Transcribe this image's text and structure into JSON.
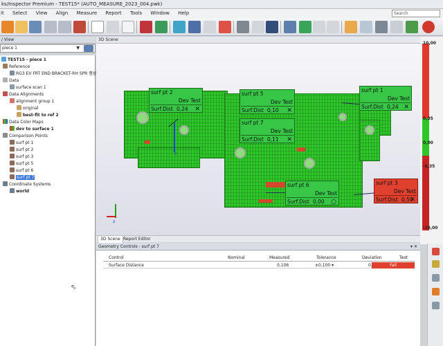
{
  "window": {
    "title": "ks/Inspector Premium - TEST15* (AUTO_MEASURE_2023_004.pwk)"
  },
  "menu": {
    "items": [
      "it",
      "Select",
      "View",
      "Align",
      "Measure",
      "Report",
      "Tools",
      "Window",
      "Help"
    ],
    "search_label": "Search"
  },
  "tree_panel": {
    "header": "/ View",
    "piece_selector": "piece 1",
    "root": "TEST15 - piece 1",
    "nodes": [
      {
        "label": "Reference",
        "indent": 1
      },
      {
        "label": "RG3 EV FRT END BRACKET-RH SPR 캠상",
        "indent": 2
      },
      {
        "label": "Data",
        "indent": 1
      },
      {
        "label": "surface scan 1",
        "indent": 2
      },
      {
        "label": "Data Alignments",
        "indent": 1
      },
      {
        "label": "alignment group 1",
        "indent": 2
      },
      {
        "label": "original",
        "indent": 3
      },
      {
        "label": "best-fit to ref 2",
        "indent": 3
      },
      {
        "label": "Data Color Maps",
        "indent": 1
      },
      {
        "label": "dev to surface 1",
        "indent": 2
      },
      {
        "label": "Comparison Points",
        "indent": 1
      },
      {
        "label": "surf pt 1",
        "indent": 2
      },
      {
        "label": "surf pt 2",
        "indent": 2
      },
      {
        "label": "surf pt 3",
        "indent": 2
      },
      {
        "label": "surf pt 5",
        "indent": 2
      },
      {
        "label": "surf pt 6",
        "indent": 2
      },
      {
        "label": "surf pt 7",
        "indent": 2
      },
      {
        "label": "Coordinate Systems",
        "indent": 1
      },
      {
        "label": "world",
        "indent": 2
      }
    ]
  },
  "scene": {
    "header": "3D Scene",
    "axis_label": "z",
    "callouts": [
      {
        "name": "surf pt 2",
        "head": "Dev Test",
        "label": "Surf.Dist",
        "value": "0,24",
        "mark": "✕",
        "status": "pass"
      },
      {
        "name": "surf pt 5",
        "head": "Dev Test",
        "label": "Surf.Dist",
        "value": "0,10",
        "mark": "✕",
        "status": "pass"
      },
      {
        "name": "surf pt 7",
        "head": "Dev Test",
        "label": "Surf.Dist",
        "value": "0,11",
        "mark": "✕",
        "status": "pass"
      },
      {
        "name": "surf pt 1",
        "head": "Dev Test",
        "label": "Surf.Dist",
        "value": "0,24",
        "mark": "✕",
        "status": "pass"
      },
      {
        "name": "surf pt 6",
        "head": "Dev Test",
        "label": "Surf.Dist",
        "value": "0,00",
        "mark": "○",
        "status": "pass"
      },
      {
        "name": "surf pt 3",
        "head": "Dev Test",
        "label": "Surf.Dist",
        "value": "0,59",
        "mark": "✕",
        "status": "fail"
      }
    ],
    "tabs": [
      "3D Scene",
      "Report Editor"
    ]
  },
  "color_scale": {
    "labels": [
      "10,00",
      "0,35",
      "0,00",
      "-0,35",
      "-10,00"
    ],
    "colors": {
      "high": "#e0392b",
      "mid": "#2fc629",
      "low": "#c62424"
    }
  },
  "geometry_controls": {
    "header": "Geometry Controls - surf pt 7",
    "panel_buttons": "▾ ✕",
    "columns": [
      "Control",
      "Nominal",
      "Measured",
      "Tolerance",
      "Deviation",
      "Test"
    ],
    "rows": [
      {
        "control": "Surface Distance",
        "nominal": "",
        "measured": "0,106",
        "tolerance": "±0,100 ▾",
        "deviation": "0,106",
        "test": "Fail"
      }
    ]
  }
}
